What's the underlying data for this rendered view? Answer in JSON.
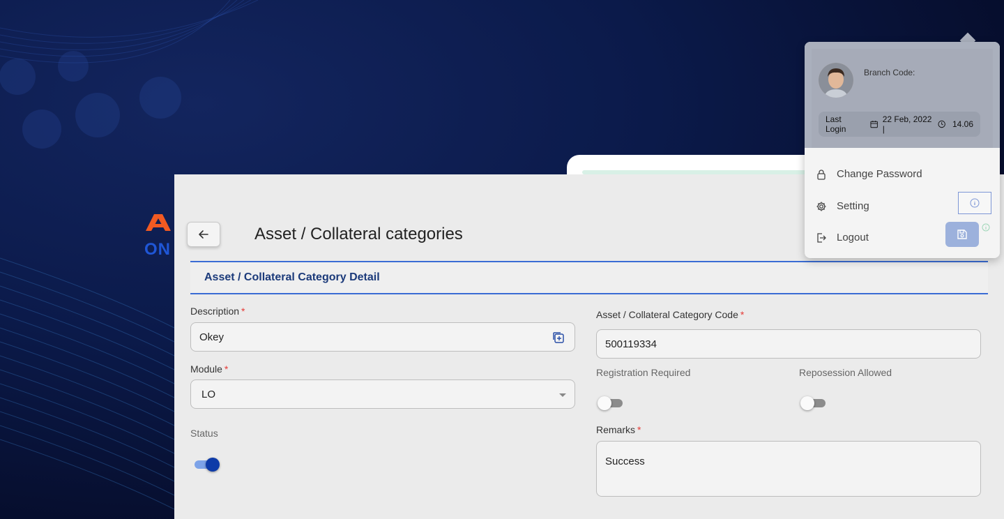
{
  "brand": {
    "logo_text": "ON"
  },
  "page": {
    "title": "Asset / Collateral categories"
  },
  "section": {
    "title": "Asset / Collateral Category Detail"
  },
  "form": {
    "description": {
      "label": "Description",
      "required": "*",
      "value": "Okey"
    },
    "module": {
      "label": "Module",
      "required": "*",
      "value": "LO"
    },
    "status": {
      "label": "Status",
      "enabled": true
    },
    "category_code": {
      "label": "Asset / Collateral Category Code",
      "required": "*",
      "value": "500119334"
    },
    "registration_required": {
      "label": "Registration Required",
      "enabled": false
    },
    "reposession_allowed": {
      "label": "Reposession Allowed",
      "enabled": false
    },
    "remarks": {
      "label": "Remarks",
      "required": "*",
      "value": "Success"
    }
  },
  "profile_menu": {
    "branch_code_label": "Branch Code:",
    "last_login_label": "Last Login",
    "last_login_date": "22 Feb, 2022 |",
    "last_login_time": "14.06",
    "items": [
      {
        "label": "Change Password",
        "icon": "lock-icon"
      },
      {
        "label": "Setting",
        "icon": "gear-icon"
      },
      {
        "label": "Logout",
        "icon": "logout-icon"
      }
    ]
  },
  "colors": {
    "accent": "#3a6cd4",
    "toggle_on": "#0e3ba8",
    "logo_orange": "#f15a22",
    "required": "#e53935"
  }
}
